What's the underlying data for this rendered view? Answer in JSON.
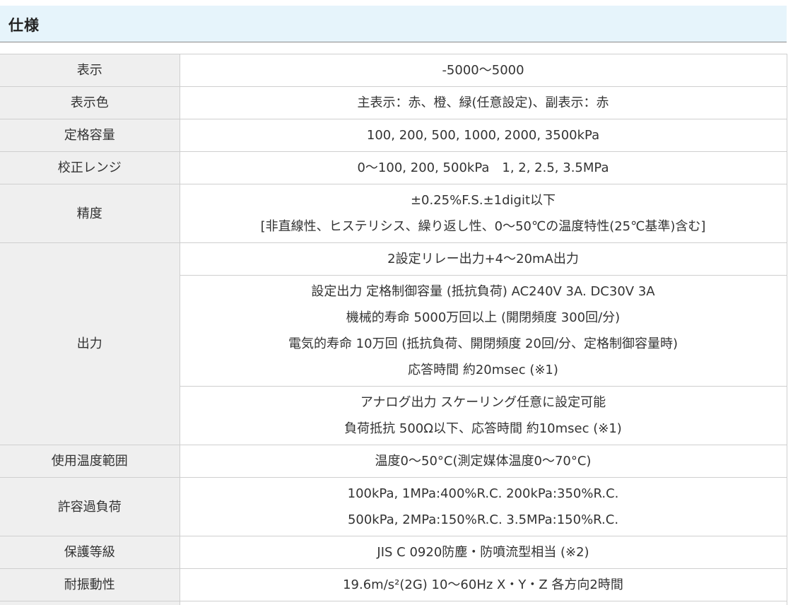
{
  "section": {
    "title": "仕様"
  },
  "rows": [
    {
      "label": "表示",
      "lines": [
        "-5000～5000"
      ]
    },
    {
      "label": "表示色",
      "lines": [
        "主表示：赤、橙、緑(任意設定)、副表示：赤"
      ]
    },
    {
      "label": "定格容量",
      "lines": [
        "100, 200, 500, 1000, 2000, 3500kPa"
      ]
    },
    {
      "label": "校正レンジ",
      "lines": [
        "0～100, 200, 500kPa　1, 2, 2.5, 3.5MPa"
      ]
    },
    {
      "label": "精度",
      "lines": [
        "±0.25%F.S.±1digit以下",
        "[非直線性、ヒステリシス、繰り返し性、0～50℃の温度特性(25℃基準)含む]"
      ]
    },
    {
      "label": "出力",
      "groups": [
        {
          "lines": [
            "2設定リレー出力+4～20mA出力"
          ]
        },
        {
          "lines": [
            "設定出力 定格制御容量 (抵抗負荷) AC240V 3A. DC30V 3A",
            "機械的寿命 5000万回以上 (開閉頻度 300回/分)",
            "電気的寿命 10万回 (抵抗負荷、開閉頻度 20回/分、定格制御容量時)",
            "応答時間 約20msec (※1)"
          ]
        },
        {
          "lines": [
            "アナログ出力 スケーリング任意に設定可能",
            "負荷抵抗 500Ω以下、応答時間 約10msec (※1)"
          ]
        }
      ]
    },
    {
      "label": "使用温度範囲",
      "lines": [
        "温度0～50°C(測定媒体温度0～70°C)"
      ]
    },
    {
      "label": "許容過負荷",
      "lines": [
        "100kPa, 1MPa:400%R.C. 200kPa:350%R.C.",
        "500kPa, 2MPa:150%R.C. 3.5MPa:150%R.C."
      ]
    },
    {
      "label": "保護等級",
      "lines": [
        "JIS C 0920防塵・防噴流型相当 (※2)"
      ]
    },
    {
      "label": "耐振動性",
      "lines": [
        "19.6m/s²(2G) 10～60Hz X・Y・Z 各方向2時間"
      ]
    }
  ]
}
